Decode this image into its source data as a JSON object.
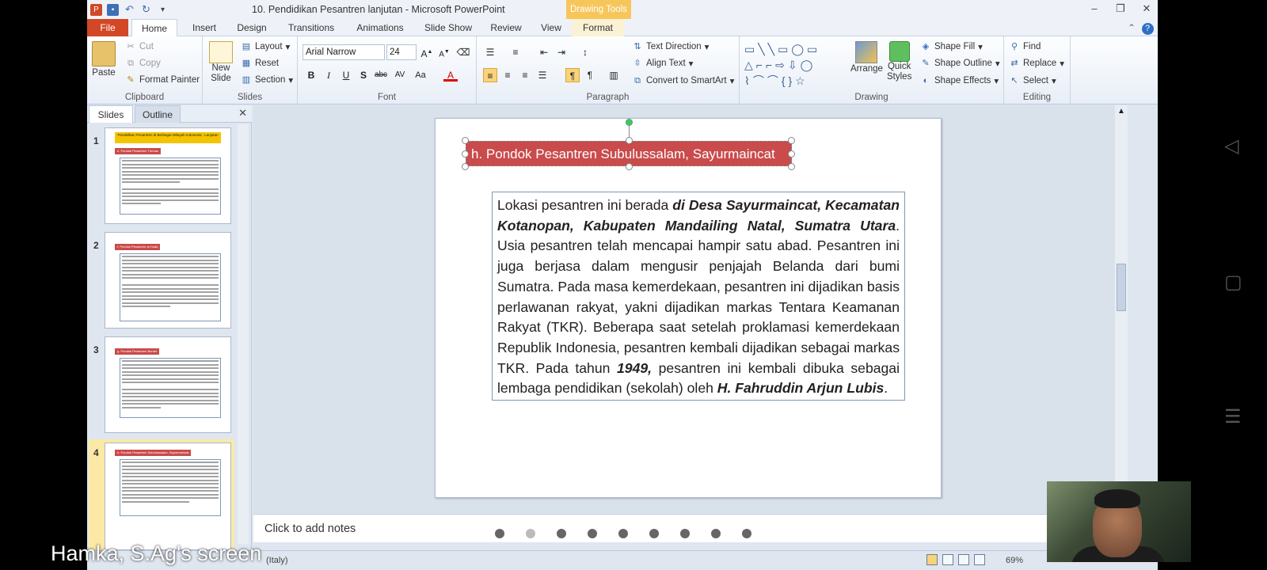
{
  "window": {
    "title": "10. Pendidikan Pesantren lanjutan - Microsoft PowerPoint",
    "context_tab": "Drawing Tools"
  },
  "tabs": [
    "File",
    "Home",
    "Insert",
    "Design",
    "Transitions",
    "Animations",
    "Slide Show",
    "Review",
    "View",
    "Format"
  ],
  "ribbon": {
    "clipboard": {
      "paste": "Paste",
      "cut": "Cut",
      "copy": "Copy",
      "format_painter": "Format Painter",
      "label": "Clipboard"
    },
    "slides": {
      "new_slide_1": "New",
      "new_slide_2": "Slide",
      "layout": "Layout",
      "reset": "Reset",
      "section": "Section",
      "label": "Slides"
    },
    "font": {
      "family": "Arial Narrow",
      "size": "24",
      "label": "Font"
    },
    "paragraph": {
      "text_direction": "Text Direction",
      "align_text": "Align Text",
      "convert_smartart": "Convert to SmartArt",
      "label": "Paragraph"
    },
    "drawing": {
      "arrange": "Arrange",
      "quick_styles_1": "Quick",
      "quick_styles_2": "Styles",
      "shape_fill": "Shape Fill",
      "shape_outline": "Shape Outline",
      "shape_effects": "Shape Effects",
      "label": "Drawing"
    },
    "editing": {
      "find": "Find",
      "replace": "Replace",
      "select": "Select",
      "label": "Editing"
    }
  },
  "panel": {
    "tab_slides": "Slides",
    "tab_outline": "Outline"
  },
  "thumbnails": [
    {
      "num": "1",
      "title": "e. Pondok Pesantren Tremas"
    },
    {
      "num": "2",
      "title": "f. Pondok Pesantren al-Huda"
    },
    {
      "num": "3",
      "title": "g. Pondok Pesantren Buntet"
    },
    {
      "num": "4",
      "title": "h. Pondok Pesantren Subulussalam, Sayurmaincat"
    }
  ],
  "thumb1_header": "Pendidikan Pesantren di Berbagai Wilayah Indonesia : Lanjutan",
  "slide": {
    "title": "h. Pondok Pesantren Subulussalam, Sayurmaincat",
    "body": [
      {
        "t": "Lokasi pesantren ini berada ",
        "b": false
      },
      {
        "t": "di Desa Sayurmaincat, Kecamatan Kotanopan, Kabupaten Mandailing Natal, Sumatra Utara",
        "b": true
      },
      {
        "t": ". Usia pesantren telah mencapai hampir satu abad. Pesantren ini juga berjasa dalam mengusir penjajah Belanda dari bumi Sumatra. Pada masa kemerdekaan, pesantren ini dijadikan basis perlawanan rakyat, yakni dijadikan markas Tentara Keamanan Rakyat (TKR). Beberapa saat setelah proklamasi kemerdekaan Republik Indonesia, pesantren kembali dijadikan sebagai markas TKR. Pada tahun ",
        "b": false
      },
      {
        "t": "1949,",
        "b": true
      },
      {
        "t": " pesantren ini kembali dibuka sebagai lembaga pendidikan (sekolah) oleh ",
        "b": false
      },
      {
        "t": "H. Fahruddin Arjun Lubis",
        "b": true
      },
      {
        "t": ".",
        "b": false
      }
    ]
  },
  "notes_placeholder": "Click to add notes",
  "status": {
    "language": "(Italy)",
    "zoom": "69%"
  },
  "screen_share_label": "Hamka, S.Ag's screen"
}
